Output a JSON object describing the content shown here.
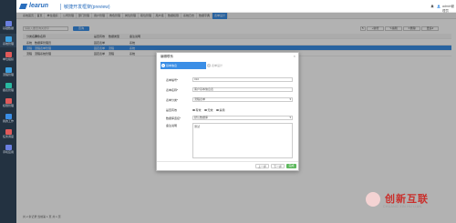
{
  "brand": {
    "logo": "learun",
    "subtitle": "敏捷开发框架(preview)"
  },
  "header": {
    "user": "admin管理员"
  },
  "nav": [
    {
      "label": "基础数据",
      "icon": "#6a7fe0"
    },
    {
      "label": "系统管理",
      "icon": "#3aa0e0"
    },
    {
      "label": "单位组织",
      "icon": "#e05a5a"
    },
    {
      "label": "流程管理",
      "icon": "#3aa0e0"
    },
    {
      "label": "报表管理",
      "icon": "#28b8a0"
    },
    {
      "label": "权限管理",
      "icon": "#e05a5a"
    },
    {
      "label": "我的工作",
      "icon": "#3a8ee6"
    },
    {
      "label": "任务调度",
      "icon": "#e05a5a"
    },
    {
      "label": "手机应用",
      "icon": "#6a7fe0"
    }
  ],
  "tabs": [
    "系统首页",
    "首页",
    "单位组织",
    "公司管理",
    "部门管理",
    "用户管理",
    "角色管理",
    "岗位管理",
    "职位管理",
    "用户组",
    "数据权限",
    "系统日志",
    "数据字典",
    "表单设计"
  ],
  "toolbar": {
    "search_placeholder": "请输入要查询关键字",
    "query": "查询",
    "refresh": "↻",
    "add": "新增",
    "edit": "编辑",
    "delete": "删除",
    "more": "更多"
  },
  "grid": {
    "headers": [
      "分类名称",
      "对象名称",
      "是否有效",
      "数据类型",
      "备注说明"
    ],
    "rows": [
      [
        "系统",
        "数据库管理员",
        "固定表单",
        "",
        "系统"
      ],
      [
        "流程",
        "流程表单管理",
        "固定表单",
        "流程",
        "系统"
      ],
      [
        "流程",
        "流程系统管理",
        "固定表单",
        "流程",
        "系统"
      ]
    ],
    "footer": "共 2 条记录 当前第 1 页 共 1 页"
  },
  "modal": {
    "title": "编辑联系",
    "close": "×",
    "steps": [
      {
        "num": "1",
        "label": "基本信息"
      },
      {
        "num": "2",
        "label": "表单设计"
      }
    ],
    "fields": {
      "code_label": "表单编号*",
      "code_value": "010",
      "name_label": "表单名称*",
      "name_value": "客户基本信息表",
      "cat_label": "表单分类*",
      "cat_value": "流程表单",
      "enabled_label": "是否有效",
      "radio_yes": "有效",
      "radio_no": "无效",
      "radio_disabled": "禁用",
      "db_label": "数据库连接*",
      "db_value": "默认数据库",
      "remark_label": "备注说明",
      "remark_value": "测试"
    },
    "buttons": {
      "prev": "上一步",
      "next": "下一步",
      "finish": "完成"
    }
  },
  "watermark": {
    "text": "创新互联",
    "sub": "CHUANG XIN HU LIAN"
  }
}
